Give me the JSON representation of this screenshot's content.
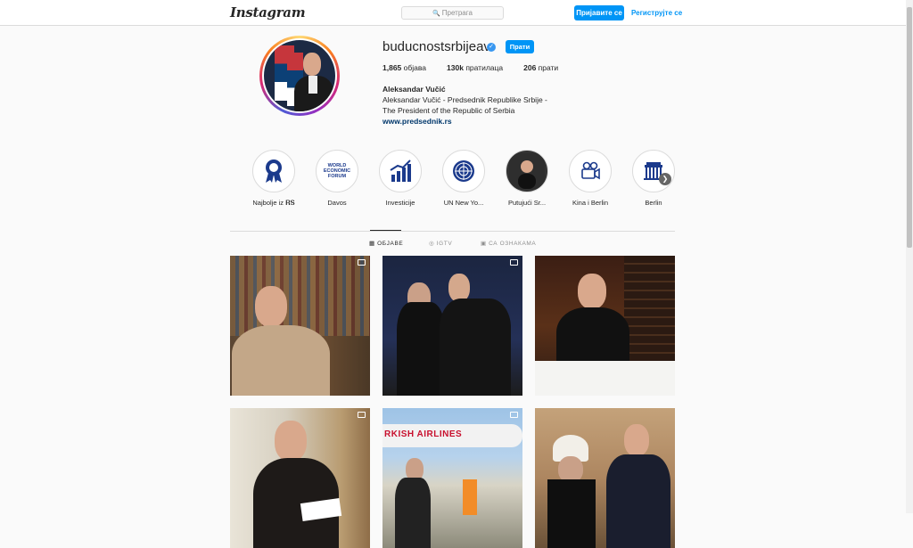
{
  "header": {
    "logo": "Instagram",
    "search_placeholder": "Претрага",
    "login_label": "Пријавите се",
    "signup_label": "Региструјте се"
  },
  "profile": {
    "username": "buducnostsrbijeav",
    "follow_label": "Прати",
    "posts_count": "1,865",
    "posts_label": "објава",
    "followers_count": "130k",
    "followers_label": "пратилаца",
    "following_count": "206",
    "following_label": "прати",
    "full_name": "Aleksandar Vučić",
    "bio_line1": "Aleksandar Vučić - Predsednik Republike Srbije -",
    "bio_line2": "The President of the Republic of Serbia",
    "website": "www.predsednik.rs"
  },
  "highlights": [
    {
      "label": "Najbolje iz 𝐑𝐒",
      "icon": "ribbon-award-icon"
    },
    {
      "label": "Davos",
      "icon": "world-economic-forum-icon"
    },
    {
      "label": "Investicije",
      "icon": "bar-chart-growth-icon"
    },
    {
      "label": "UN New Yo...",
      "icon": "un-emblem-icon"
    },
    {
      "label": "Putujući Sr...",
      "icon": "portrait-photo-icon"
    },
    {
      "label": "Kina i Berlin",
      "icon": "camera-video-icon"
    },
    {
      "label": "Berlin",
      "icon": "brandenburg-gate-icon"
    }
  ],
  "wef_text": "WORLD ECONOMIC FORUM",
  "tabs": {
    "posts": "ОБЈАВЕ",
    "igtv": "IGTV",
    "tagged": "СА ОЗНАКАМА"
  },
  "posts": [
    {
      "type": "video"
    },
    {
      "type": "carousel"
    },
    {
      "type": "photo"
    },
    {
      "type": "carousel"
    },
    {
      "type": "carousel",
      "banner": "RKISH AIRLINES"
    },
    {
      "type": "photo"
    }
  ]
}
